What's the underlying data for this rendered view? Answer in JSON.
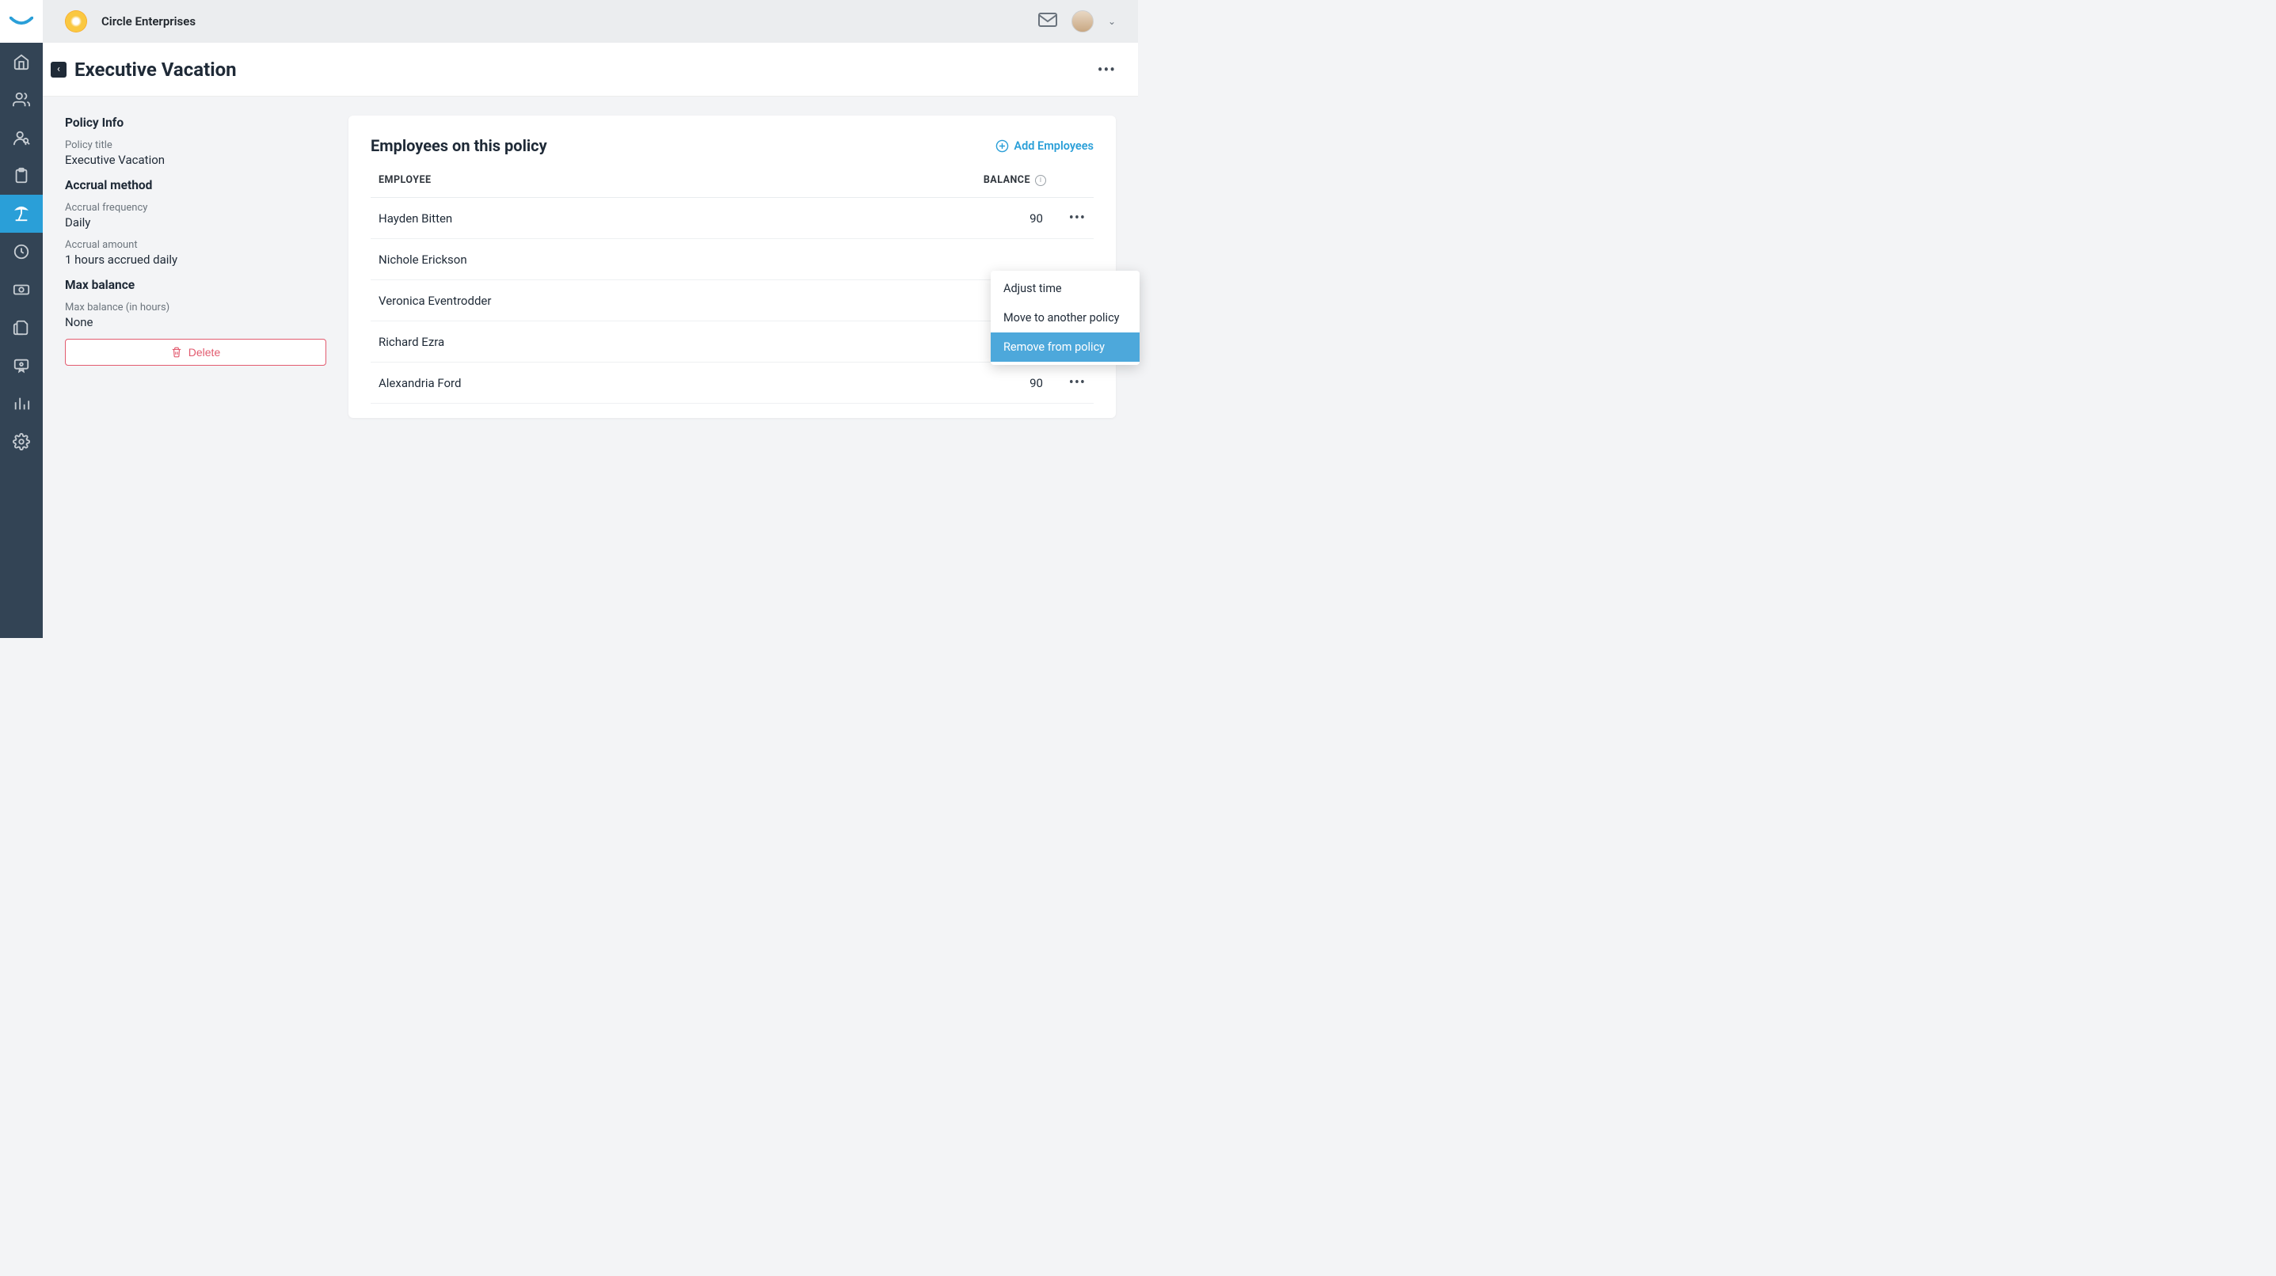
{
  "company": {
    "name": "Circle Enterprises"
  },
  "page": {
    "title": "Executive Vacation"
  },
  "policy": {
    "info_heading": "Policy Info",
    "title_label": "Policy title",
    "title_value": "Executive Vacation",
    "accrual_method_heading": "Accrual method",
    "accrual_freq_label": "Accrual frequency",
    "accrual_freq_value": "Daily",
    "accrual_amount_label": "Accrual amount",
    "accrual_amount_value": "1 hours accrued daily",
    "max_balance_heading": "Max balance",
    "max_balance_label": "Max balance (in hours)",
    "max_balance_value": "None",
    "delete_label": "Delete"
  },
  "card": {
    "title": "Employees on this policy",
    "add_label": "Add Employees",
    "col_employee": "EMPLOYEE",
    "col_balance": "BALANCE"
  },
  "employees": [
    {
      "name": "Hayden Bitten",
      "balance": "90"
    },
    {
      "name": "Nichole Erickson",
      "balance": ""
    },
    {
      "name": "Veronica Eventrodder",
      "balance": ""
    },
    {
      "name": "Richard Ezra",
      "balance": ""
    },
    {
      "name": "Alexandria Ford",
      "balance": "90"
    }
  ],
  "dropdown": {
    "adjust": "Adjust time",
    "move": "Move to another policy",
    "remove": "Remove from policy"
  }
}
